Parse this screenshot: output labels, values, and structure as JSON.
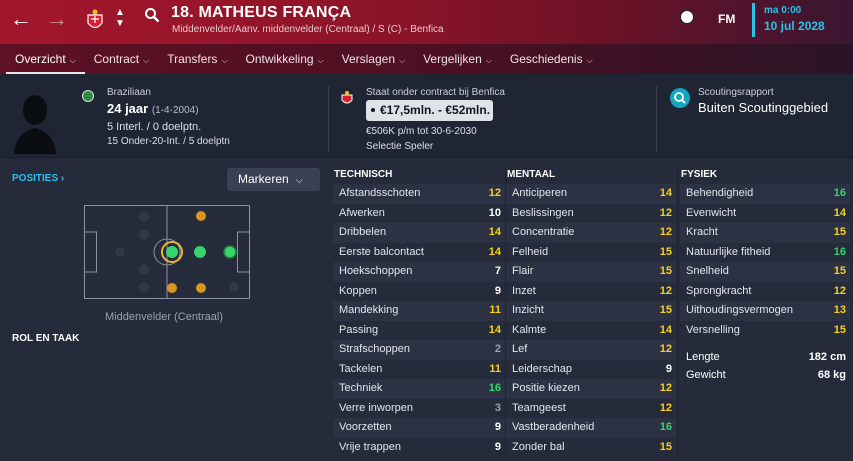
{
  "header": {
    "player_name": "18. MATHEUS FRANÇA",
    "subtitle": "Middenvelder/Aanv. middenvelder (Centraal) / S (C) - Benfica",
    "brand": "FM",
    "time": "ma 0:00",
    "date": "10 jul 2028"
  },
  "tabs": [
    {
      "label": "Overzicht"
    },
    {
      "label": "Contract"
    },
    {
      "label": "Transfers"
    },
    {
      "label": "Ontwikkeling"
    },
    {
      "label": "Verslagen"
    },
    {
      "label": "Vergelijken"
    },
    {
      "label": "Geschiedenis"
    }
  ],
  "profile": {
    "nationality": "Braziliaan",
    "age": "24 jaar",
    "birthdate": "(1-4-2004)",
    "internationals": "5 Interl. / 0 doelptn.",
    "u20": "15 Onder-20-Int. / 5 doelptn"
  },
  "contract": {
    "title": "Staat onder contract bij Benfica",
    "value": "€17,5mln. - €52mln.",
    "wage": "€506K p/m tot 30-6-2030",
    "selection": "Selectie Speler"
  },
  "scouting": {
    "label": "Scoutingsrapport",
    "value": "Buiten Scoutinggebied"
  },
  "positions": {
    "heading": "POSITIES",
    "mark_button": "Markeren",
    "position_label": "Middenvelder (Centraal)",
    "role_heading": "ROL EN TAAK"
  },
  "technical": {
    "heading": "TECHNISCH",
    "rows": [
      {
        "name": "Afstandsschoten",
        "value": "12",
        "c": "yl"
      },
      {
        "name": "Afwerken",
        "value": "10",
        "c": "wh"
      },
      {
        "name": "Dribbelen",
        "value": "14",
        "c": "yl"
      },
      {
        "name": "Eerste balcontact",
        "value": "14",
        "c": "yl"
      },
      {
        "name": "Hoekschoppen",
        "value": "7",
        "c": "wh"
      },
      {
        "name": "Koppen",
        "value": "9",
        "c": "wh"
      },
      {
        "name": "Mandekking",
        "value": "11",
        "c": "yl"
      },
      {
        "name": "Passing",
        "value": "14",
        "c": "yl"
      },
      {
        "name": "Strafschoppen",
        "value": "2",
        "c": "gy"
      },
      {
        "name": "Tackelen",
        "value": "11",
        "c": "yl"
      },
      {
        "name": "Techniek",
        "value": "16",
        "c": "gr"
      },
      {
        "name": "Verre inworpen",
        "value": "3",
        "c": "gy"
      },
      {
        "name": "Voorzetten",
        "value": "9",
        "c": "wh"
      },
      {
        "name": "Vrije trappen",
        "value": "9",
        "c": "wh"
      }
    ]
  },
  "mental": {
    "heading": "MENTAAL",
    "rows": [
      {
        "name": "Anticiperen",
        "value": "14",
        "c": "yl"
      },
      {
        "name": "Beslissingen",
        "value": "12",
        "c": "yl"
      },
      {
        "name": "Concentratie",
        "value": "12",
        "c": "yl"
      },
      {
        "name": "Felheid",
        "value": "15",
        "c": "yl"
      },
      {
        "name": "Flair",
        "value": "15",
        "c": "yl"
      },
      {
        "name": "Inzet",
        "value": "12",
        "c": "yl"
      },
      {
        "name": "Inzicht",
        "value": "15",
        "c": "yl"
      },
      {
        "name": "Kalmte",
        "value": "14",
        "c": "yl"
      },
      {
        "name": "Lef",
        "value": "12",
        "c": "yl"
      },
      {
        "name": "Leiderschap",
        "value": "9",
        "c": "wh"
      },
      {
        "name": "Positie kiezen",
        "value": "12",
        "c": "yl"
      },
      {
        "name": "Teamgeest",
        "value": "12",
        "c": "yl"
      },
      {
        "name": "Vastberadenheid",
        "value": "16",
        "c": "gr"
      },
      {
        "name": "Zonder bal",
        "value": "15",
        "c": "yl"
      }
    ]
  },
  "physical": {
    "heading": "FYSIEK",
    "rows": [
      {
        "name": "Behendigheid",
        "value": "16",
        "c": "gr"
      },
      {
        "name": "Evenwicht",
        "value": "14",
        "c": "yl"
      },
      {
        "name": "Kracht",
        "value": "15",
        "c": "yl"
      },
      {
        "name": "Natuurlijke fitheid",
        "value": "16",
        "c": "gr"
      },
      {
        "name": "Snelheid",
        "value": "15",
        "c": "yl"
      },
      {
        "name": "Sprongkracht",
        "value": "12",
        "c": "yl"
      },
      {
        "name": "Uithoudingsvermogen",
        "value": "13",
        "c": "yl"
      },
      {
        "name": "Versnelling",
        "value": "15",
        "c": "yl"
      }
    ],
    "height_label": "Lengte",
    "height": "182 cm",
    "weight_label": "Gewicht",
    "weight": "68 kg"
  },
  "colors": {
    "accent": "#2bc0ea",
    "good": "#36d46a",
    "mid": "#f5d11d"
  }
}
